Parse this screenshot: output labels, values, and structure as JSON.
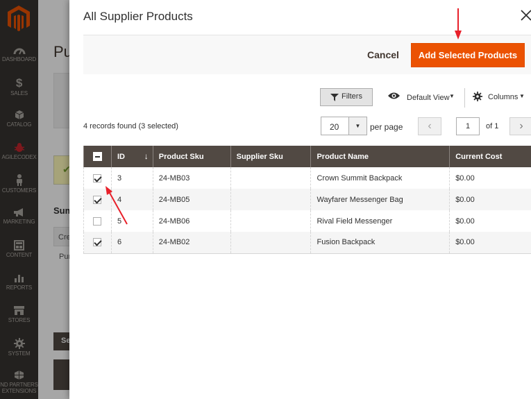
{
  "sidebar": {
    "items": [
      {
        "label": "DASHBOARD",
        "icon": "dashboard-icon"
      },
      {
        "label": "SALES",
        "icon": "dollar-icon"
      },
      {
        "label": "CATALOG",
        "icon": "box-icon"
      },
      {
        "label": "AGILECODEX",
        "icon": "bug-icon"
      },
      {
        "label": "CUSTOMERS",
        "icon": "person-icon"
      },
      {
        "label": "MARKETING",
        "icon": "megaphone-icon"
      },
      {
        "label": "CONTENT",
        "icon": "layout-icon"
      },
      {
        "label": "REPORTS",
        "icon": "bar-chart-icon"
      },
      {
        "label": "STORES",
        "icon": "store-icon"
      },
      {
        "label": "SYSTEM",
        "icon": "gear-icon"
      },
      {
        "label": "ND PARTNERS EXTENSIONS",
        "icon": "blocks-icon"
      }
    ]
  },
  "page": {
    "title": "Pu",
    "section": "Sum",
    "tab": "Cre",
    "sub": "Pur",
    "dark_button": "Se"
  },
  "modal": {
    "title": "All Supplier Products",
    "cancel_label": "Cancel",
    "add_label": "Add Selected Products"
  },
  "toolbar": {
    "filters_label": "Filters",
    "view_label": "Default View",
    "columns_label": "Columns",
    "records_text": "4 records found (3 selected)",
    "per_page_value": "20",
    "per_page_label": "per page",
    "prev_label": "‹",
    "page_value": "1",
    "of_label": "of 1",
    "next_label": "›"
  },
  "table": {
    "headers": [
      "ID",
      "Product Sku",
      "Supplier Sku",
      "Product Name",
      "Current Cost"
    ],
    "rows": [
      {
        "checked": true,
        "id": "3",
        "sku": "24-MB03",
        "supplier_sku": "",
        "name": "Crown Summit Backpack",
        "cost": "$0.00"
      },
      {
        "checked": true,
        "id": "4",
        "sku": "24-MB05",
        "supplier_sku": "",
        "name": "Wayfarer Messenger Bag",
        "cost": "$0.00"
      },
      {
        "checked": false,
        "id": "5",
        "sku": "24-MB06",
        "supplier_sku": "",
        "name": "Rival Field Messenger",
        "cost": "$0.00"
      },
      {
        "checked": true,
        "id": "6",
        "sku": "24-MB02",
        "supplier_sku": "",
        "name": "Fusion Backpack",
        "cost": "$0.00"
      }
    ]
  },
  "colors": {
    "accent": "#eb5202",
    "header_bg": "#514943",
    "sidebar_bg": "#373330",
    "annotation": "#e8202a"
  }
}
